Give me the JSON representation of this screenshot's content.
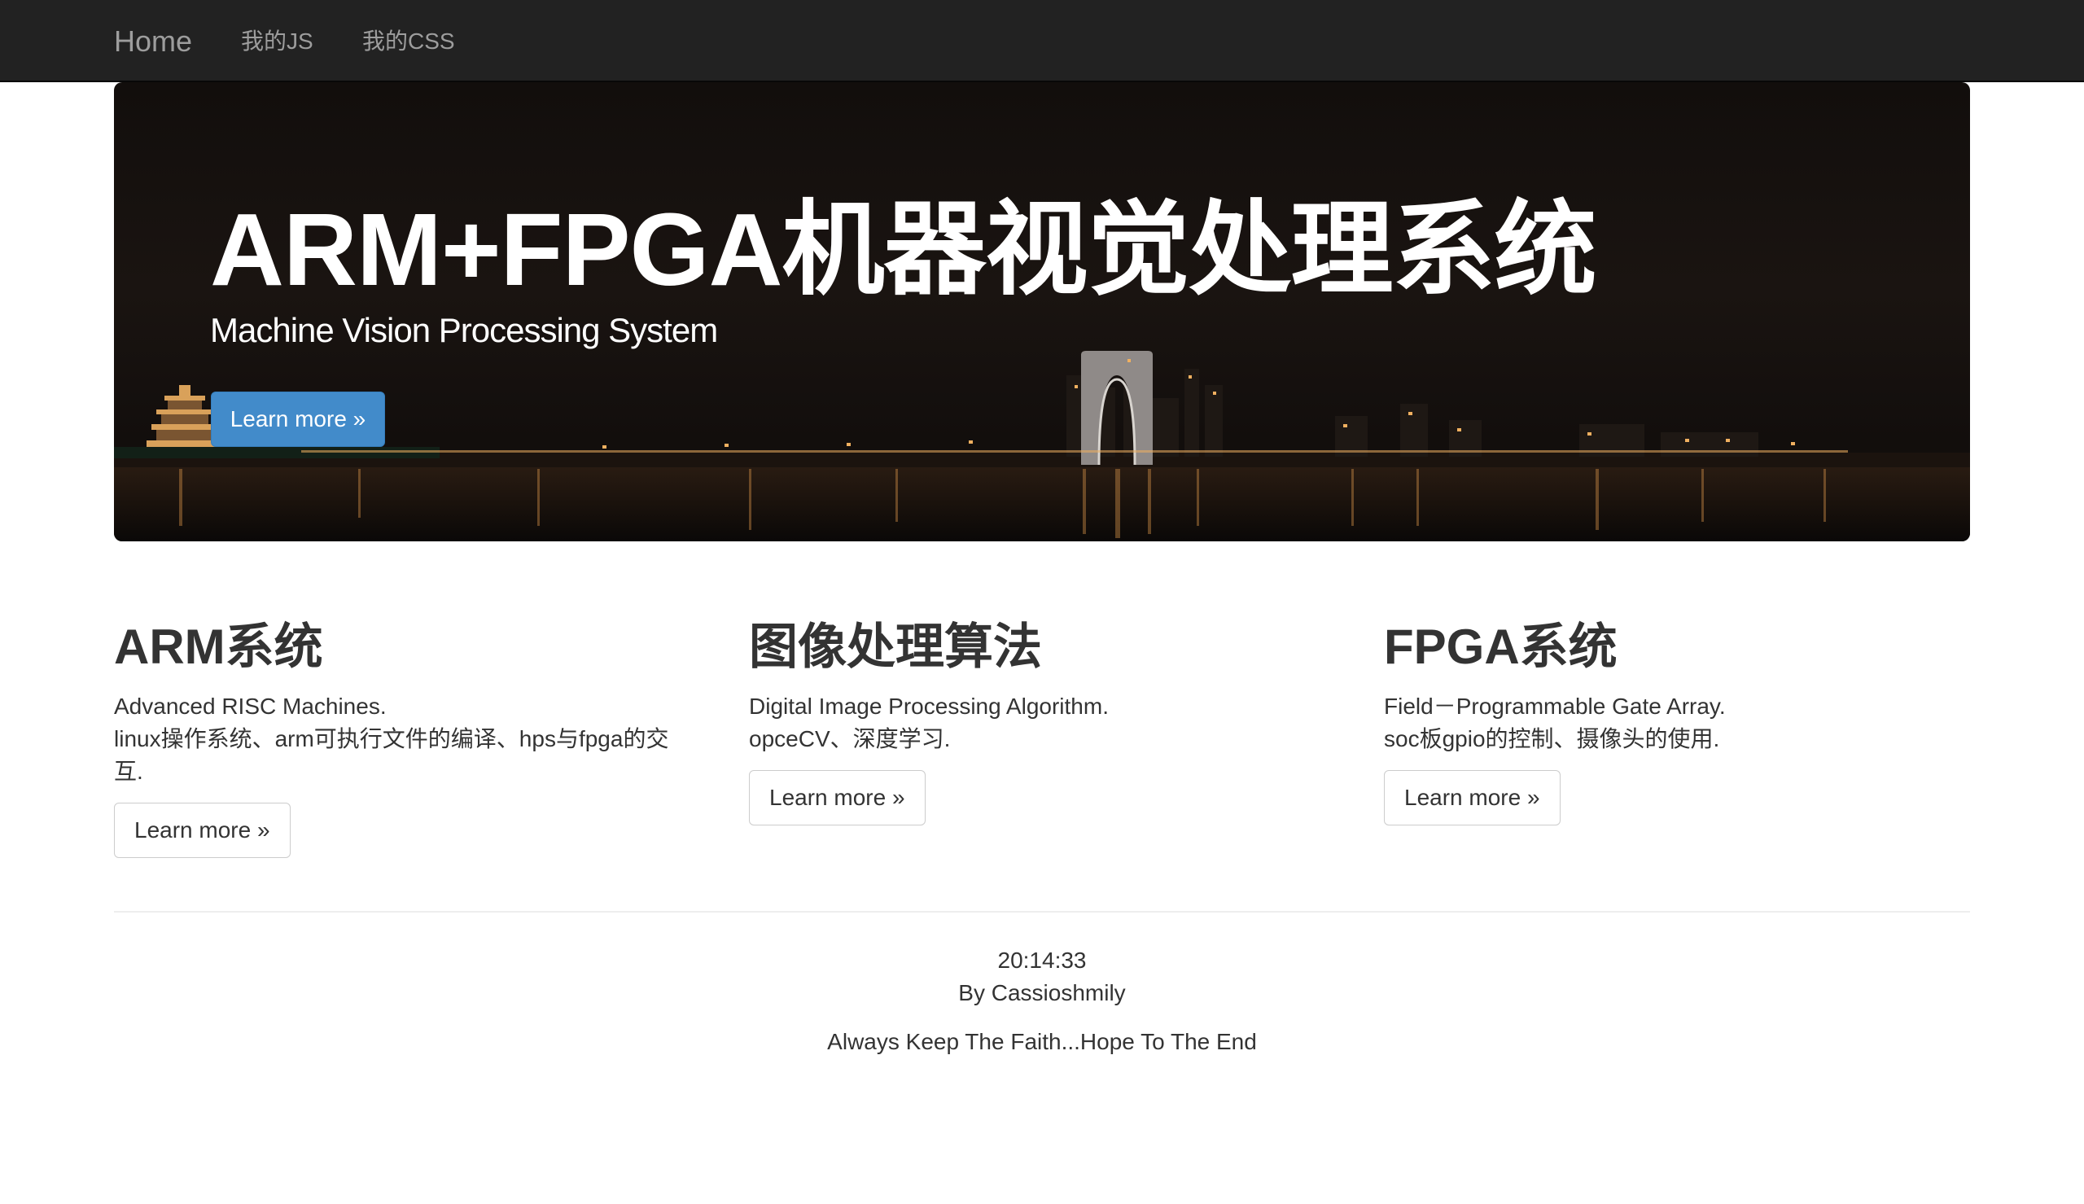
{
  "navbar": {
    "brand": "Home",
    "links": [
      "我的JS",
      "我的CSS"
    ]
  },
  "hero": {
    "title": "ARM+FPGA机器视觉处理系统",
    "subtitle": "Machine Vision Processing System",
    "button_label": "Learn more »"
  },
  "columns": [
    {
      "heading": "ARM系统",
      "lines": [
        "Advanced RISC Machines.",
        "linux操作系统、arm可执行文件的编译、hps与fpga的交互."
      ],
      "button_label": "Learn more »"
    },
    {
      "heading": "图像处理算法",
      "lines": [
        "Digital Image Processing Algorithm.",
        "opceCV、深度学习."
      ],
      "button_label": "Learn more »"
    },
    {
      "heading": "FPGA系统",
      "lines": [
        "Field－Programmable Gate Array.",
        "soc板gpio的控制、摄像头的使用."
      ],
      "button_label": "Learn more »"
    }
  ],
  "footer": {
    "time": "20:14:33",
    "author": "By Cassioshmily",
    "motto": "Always Keep The Faith...Hope To The End"
  },
  "colors": {
    "navbar_bg": "#222222",
    "nav_text": "#9d9d9d",
    "primary_button": "#428bca",
    "text": "#333333"
  }
}
